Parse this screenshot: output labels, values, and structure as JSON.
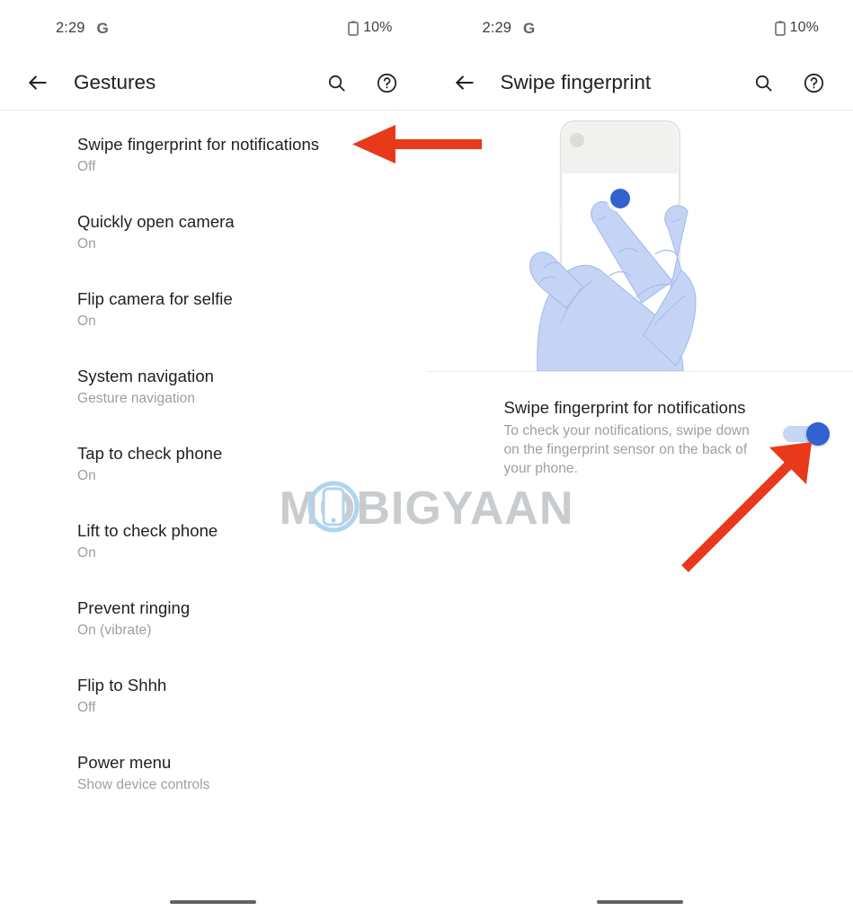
{
  "left_screen": {
    "status_bar": {
      "time": "2:29",
      "app_glyph": "G",
      "battery": "10%",
      "battery_icon": "battery-icon",
      "google_icon": "google-g-icon"
    },
    "app_bar": {
      "back_icon": "back-arrow-icon",
      "title": "Gestures",
      "search_icon": "search-icon",
      "help_icon": "help-circle-icon"
    },
    "items": [
      {
        "title": "Swipe fingerprint for notifications",
        "value": "Off"
      },
      {
        "title": "Quickly open camera",
        "value": "On"
      },
      {
        "title": "Flip camera for selfie",
        "value": "On"
      },
      {
        "title": "System navigation",
        "value": "Gesture navigation"
      },
      {
        "title": "Tap to check phone",
        "value": "On"
      },
      {
        "title": "Lift to check phone",
        "value": "On"
      },
      {
        "title": "Prevent ringing",
        "value": "On (vibrate)"
      },
      {
        "title": "Flip to Shhh",
        "value": "Off"
      },
      {
        "title": "Power menu",
        "value": "Show device controls"
      }
    ]
  },
  "right_screen": {
    "status_bar": {
      "time": "2:29",
      "app_glyph": "G",
      "battery": "10%",
      "battery_icon": "battery-icon",
      "google_icon": "google-g-icon"
    },
    "app_bar": {
      "back_icon": "back-arrow-icon",
      "title": "Swipe fingerprint",
      "search_icon": "search-icon",
      "help_icon": "help-circle-icon"
    },
    "illustration": {
      "name": "swipe-fingerprint-illustration",
      "description": "Hand swiping down on the rear fingerprint sensor of a phone"
    },
    "detail": {
      "title": "Swipe fingerprint for notifications",
      "description": "To check your notifications, swipe down on the fingerprint sensor on the back of your phone.",
      "toggle_state": "on"
    }
  },
  "annotations": {
    "arrow_left": "red-arrow-pointing-left",
    "arrow_right": "red-arrow-pointing-up-right",
    "arrow_color": "#E8391A"
  },
  "watermark": {
    "text": "MOBIGYAAN",
    "color": "#C9CCCE",
    "accent_color": "#AFD5EE"
  },
  "colors": {
    "accent": "#3063d0",
    "toggle_track": "#c6d6f5",
    "title_text": "#202124",
    "secondary_text": "#9aa0a6",
    "divider": "#ececec",
    "illustration_hand": "#c5d4f5",
    "illustration_phone_outline": "#e3e3e0",
    "illustration_dot": "#3063d0"
  }
}
